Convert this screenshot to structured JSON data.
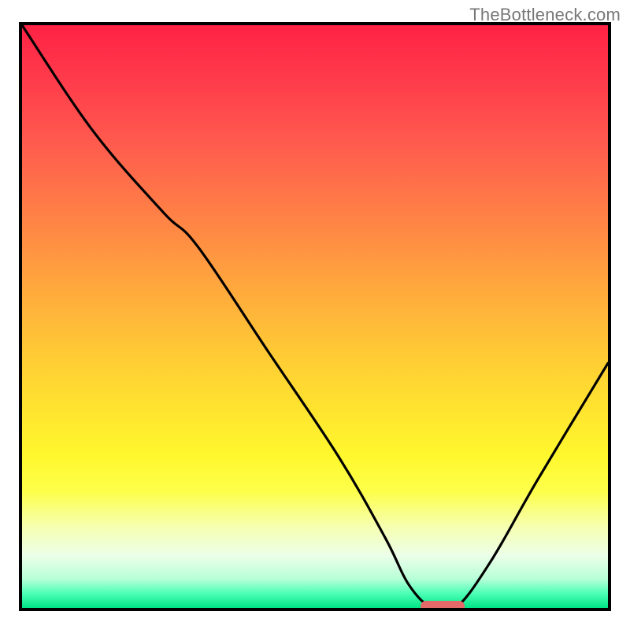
{
  "watermark": "TheBottleneck.com",
  "chart_data": {
    "type": "line",
    "title": "",
    "xlabel": "",
    "ylabel": "",
    "xlim": [
      0,
      100
    ],
    "ylim": [
      0,
      100
    ],
    "series": [
      {
        "name": "bottleneck-curve",
        "x": [
          0,
          12,
          24,
          30,
          42,
          54,
          62,
          66,
          70,
          74,
          80,
          88,
          100
        ],
        "y": [
          100,
          82,
          68,
          62,
          44,
          26,
          12,
          4,
          0,
          0,
          8,
          22,
          42
        ]
      }
    ],
    "optimum_marker": {
      "x": 71,
      "y": 0,
      "label": ""
    },
    "background_gradient": {
      "from": "#ff2244",
      "to": "#00e385",
      "stops": [
        "red",
        "orange",
        "yellow",
        "green"
      ]
    }
  }
}
